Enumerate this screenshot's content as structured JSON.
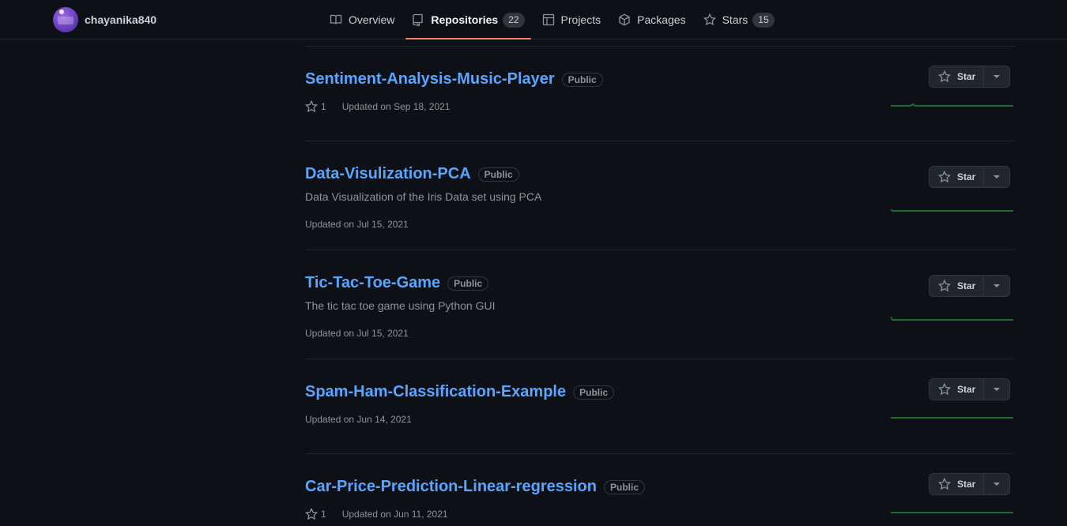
{
  "profile": {
    "username": "chayanika840"
  },
  "tabs": [
    {
      "label": "Overview",
      "icon": "book-icon"
    },
    {
      "label": "Repositories",
      "icon": "repo-icon",
      "count": "22",
      "active": true
    },
    {
      "label": "Projects",
      "icon": "table-icon"
    },
    {
      "label": "Packages",
      "icon": "package-icon"
    },
    {
      "label": "Stars",
      "icon": "star-icon",
      "count": "15"
    }
  ],
  "star_button_label": "Star",
  "repos": [
    {
      "name": "Sentiment-Analysis-Music-Player",
      "visibility": "Public",
      "description": "",
      "stars": "1",
      "updated": "Updated on Sep 18, 2021"
    },
    {
      "name": "Data-Visulization-PCA",
      "visibility": "Public",
      "description": "Data Visualization of the Iris Data set using PCA",
      "stars": "",
      "updated": "Updated on Jul 15, 2021"
    },
    {
      "name": "Tic-Tac-Toe-Game",
      "visibility": "Public",
      "description": "The tic tac toe game using Python GUI",
      "stars": "",
      "updated": "Updated on Jul 15, 2021"
    },
    {
      "name": "Spam-Ham-Classification-Example",
      "visibility": "Public",
      "description": "",
      "stars": "",
      "updated": "Updated on Jun 14, 2021"
    },
    {
      "name": "Car-Price-Prediction-Linear-regression",
      "visibility": "Public",
      "description": "",
      "stars": "1",
      "updated": "Updated on Jun 11, 2021"
    }
  ],
  "colors": {
    "link": "#58a6ff",
    "active_tab_underline": "#f78166",
    "sparkline": "#196c2e",
    "background": "#0d1117"
  }
}
